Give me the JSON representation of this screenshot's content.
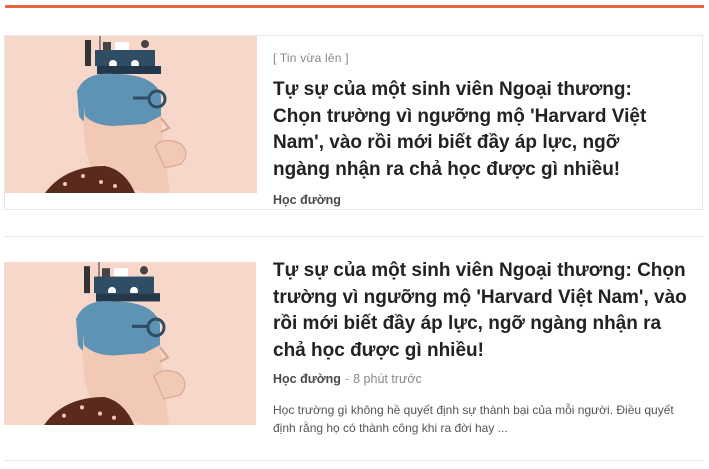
{
  "colors": {
    "accent": "#e8673f",
    "thumb_bg": "#f7d7c9",
    "hair": "#5f93b4",
    "skin": "#f1c9b5",
    "shirt": "#5a2a1e"
  },
  "articles": [
    {
      "tag": "[ Tin vừa lên ]",
      "title": "Tự sự của một sinh viên Ngoại thương: Chọn trường vì ngưỡng mộ 'Harvard Việt Nam', vào rồi mới biết đầy áp lực, ngỡ ngàng nhận ra chả học được gì nhiều!",
      "category": "Học đường",
      "thumbnail_icon": "student-head-illustration"
    },
    {
      "title": "Tự sự của một sinh viên Ngoại thương: Chọn trường vì ngưỡng mộ 'Harvard Việt Nam', vào rồi mới biết đầy áp lực, ngỡ ngàng nhận ra chả học được gì nhiều!",
      "category": "Học đường",
      "separator": "-",
      "time": "8 phút trước",
      "excerpt": "Học trường gì không hề quyết định sự thành bại của mỗi người. Điều quyết định rằng họ có thành công khi ra đời hay ...",
      "thumbnail_icon": "student-head-illustration"
    }
  ]
}
